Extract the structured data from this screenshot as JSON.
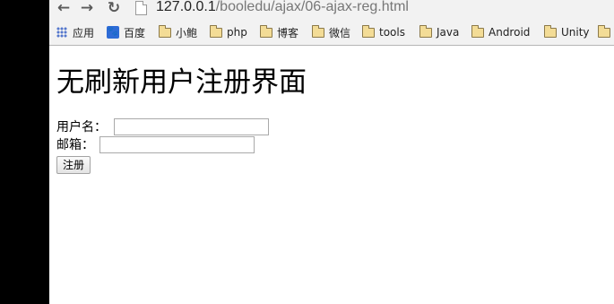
{
  "browser": {
    "url_host": "127.0.0.1",
    "url_path": "/booledu/ajax/06-ajax-reg.html"
  },
  "bookmarks": [
    {
      "label": "应用",
      "icon": "apps-grid-icon"
    },
    {
      "label": "百度",
      "icon": "baidu-paw-icon"
    },
    {
      "label": "小鲍",
      "icon": "folder-icon"
    },
    {
      "label": "php",
      "icon": "folder-icon"
    },
    {
      "label": "博客",
      "icon": "folder-icon"
    },
    {
      "label": "微信",
      "icon": "folder-icon"
    },
    {
      "label": "tools",
      "icon": "folder-icon"
    },
    {
      "label": "Java",
      "icon": "folder-icon"
    },
    {
      "label": "Android",
      "icon": "folder-icon"
    },
    {
      "label": "Unity",
      "icon": "folder-icon"
    }
  ],
  "page": {
    "title": "无刷新用户注册界面",
    "username_label": "用户名：",
    "email_label": "邮箱：",
    "username_value": "",
    "email_value": "",
    "submit_label": "注册"
  }
}
